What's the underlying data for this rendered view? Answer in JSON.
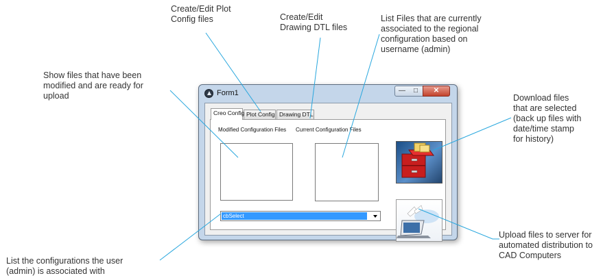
{
  "annotations": {
    "plot_config": [
      "Create/Edit Plot",
      "Config files"
    ],
    "drawing_dtl": [
      "Create/Edit",
      "Drawing DTL files"
    ],
    "list_current": [
      "List Files that are currently",
      "associated to the regional",
      "configuration based on",
      "username (admin)"
    ],
    "show_modified": [
      "Show files that have been",
      "modified and are ready for",
      "upload"
    ],
    "download": [
      "Download files",
      "that are selected",
      "(back up files with",
      "date/time stamp",
      "for history)"
    ],
    "upload": [
      "Upload files to server for",
      "automated distribution to",
      "CAD Computers"
    ],
    "list_configs": [
      "List the configurations the user",
      "(admin) is associated with"
    ]
  },
  "window": {
    "title": "Form1",
    "controls": {
      "minimize": "—",
      "maximize": "□",
      "close": "✕"
    },
    "tabs": [
      "Creo Config",
      "Plot Config",
      "Drawing DTL"
    ],
    "active_tab": "Creo Config",
    "modified_label": "Modified Configuration Files",
    "current_label": "Current Configuration Files",
    "combo_value": "cbSelect",
    "icons": {
      "app": "app-logo-icon",
      "download": "file-cabinet-icon",
      "upload": "laptop-upload-icon"
    }
  },
  "colors": {
    "accent_line": "#29a7de",
    "selection": "#3399ff",
    "window_frame": "#c4d6ea"
  }
}
